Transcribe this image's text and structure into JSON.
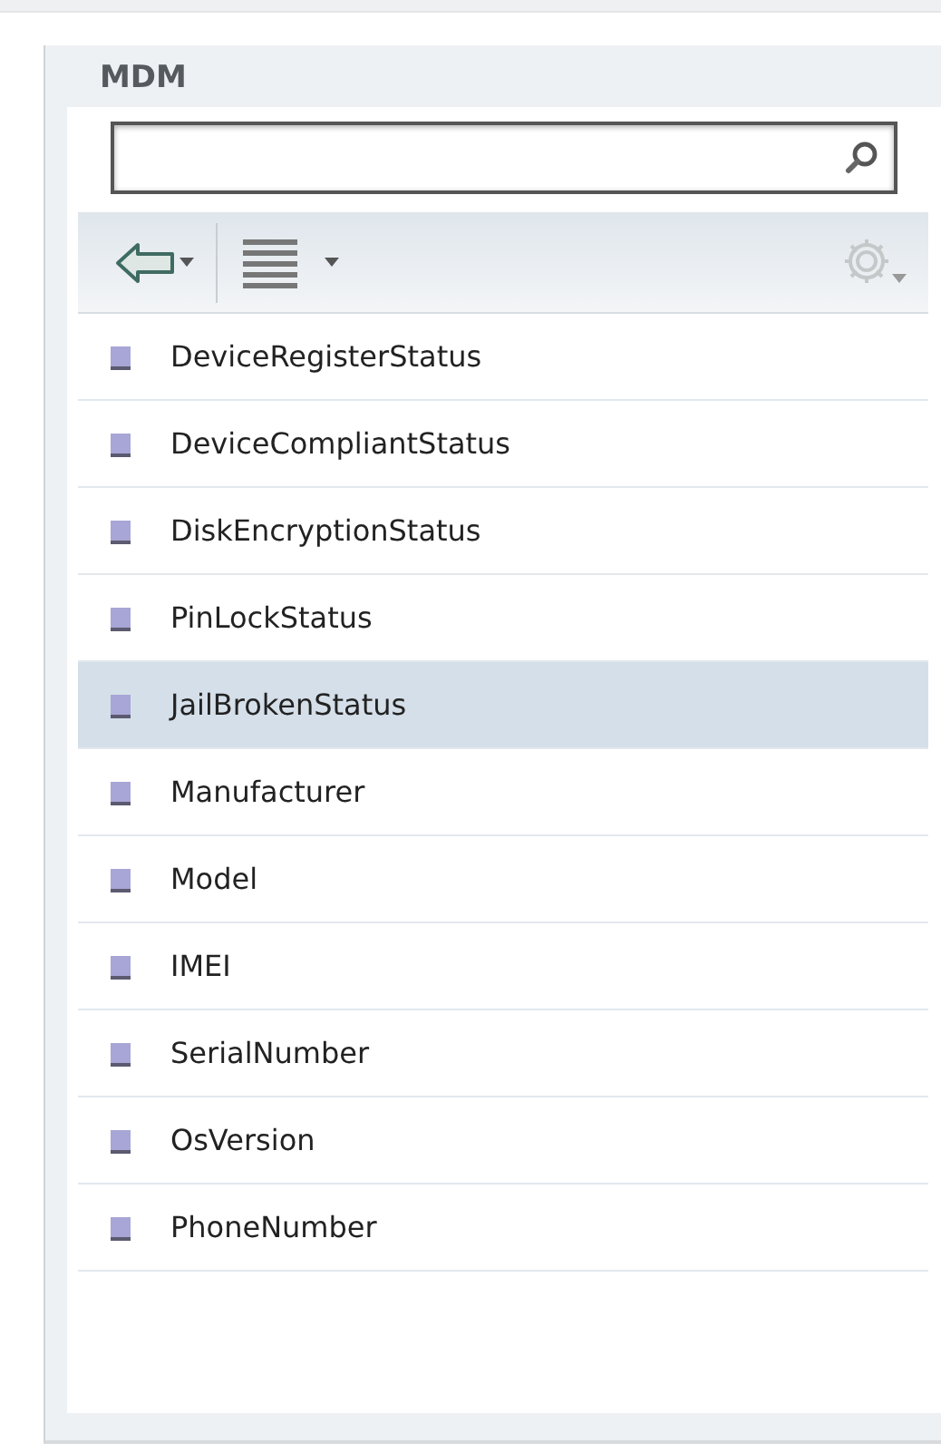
{
  "panel": {
    "title": "MDM"
  },
  "items": [
    {
      "label": "DeviceRegisterStatus",
      "selected": false
    },
    {
      "label": "DeviceCompliantStatus",
      "selected": false
    },
    {
      "label": "DiskEncryptionStatus",
      "selected": false
    },
    {
      "label": "PinLockStatus",
      "selected": false
    },
    {
      "label": "JailBrokenStatus",
      "selected": true
    },
    {
      "label": "Manufacturer",
      "selected": false
    },
    {
      "label": "Model",
      "selected": false
    },
    {
      "label": "IMEI",
      "selected": false
    },
    {
      "label": "SerialNumber",
      "selected": false
    },
    {
      "label": "OsVersion",
      "selected": false
    },
    {
      "label": "PhoneNumber",
      "selected": false
    }
  ]
}
